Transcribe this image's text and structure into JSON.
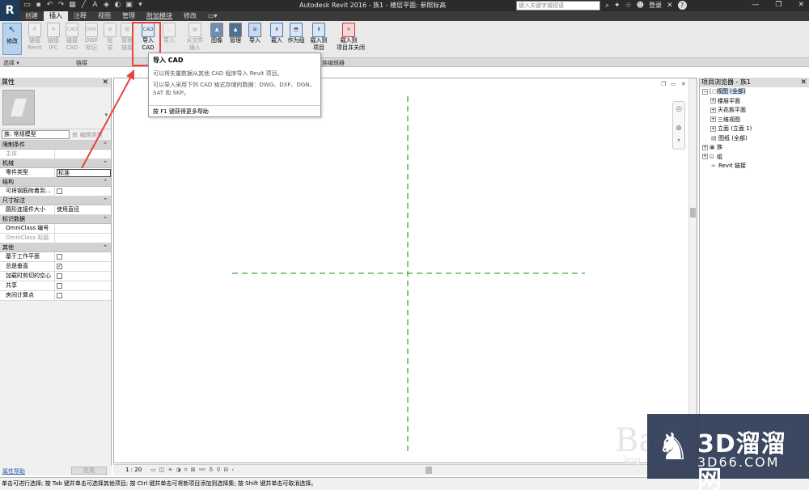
{
  "titlebar": {
    "app_logo": "R",
    "window_title": "Autodesk Revit 2016 -   族1 - 楼层平面: 参照标高",
    "search_placeholder": "键入关键字或短语",
    "login": "登录",
    "help": "?"
  },
  "tabs": [
    "创建",
    "插入",
    "注释",
    "视图",
    "管理",
    "附加模块",
    "修改"
  ],
  "active_tab": "插入",
  "ribbon": {
    "modify": "修改",
    "link_revit": [
      "链接",
      "Revit"
    ],
    "link_ifc": [
      "链接",
      "IFC"
    ],
    "link_cad": [
      "链接",
      "CAD"
    ],
    "dwf_markup": [
      "DWF",
      "标记"
    ],
    "decal": [
      "贴",
      "花"
    ],
    "manage_links": [
      "管理",
      "链接"
    ],
    "import_cad": [
      "导入",
      "CAD"
    ],
    "import_gbxml": [
      "导入",
      ""
    ],
    "from_file": [
      "从文件",
      "插入"
    ],
    "image": [
      "图像",
      ""
    ],
    "manage_images": [
      "管理",
      ""
    ],
    "import_family_types": [
      "导入",
      ""
    ],
    "load_family": [
      "载入",
      "族"
    ],
    "load_as_group": [
      "作为组",
      "载入"
    ],
    "load_into_project": [
      "载入到",
      "项目"
    ],
    "load_into_project_close": [
      "载入到",
      "项目并关闭"
    ]
  },
  "panels": {
    "select": "选择 ▾",
    "link": "链接",
    "family_editor": "族编辑器"
  },
  "tooltip": {
    "title": "导入 CAD",
    "line1": "可以将矢量数据从其他 CAD 程序导入 Revit 项目。",
    "line2": "可以导入采用下列 CAD 格式存储的数据：DWG、DXF、DGN、SAT 和 SKP。",
    "footer": "按 F1 键获得更多帮助"
  },
  "properties": {
    "title": "属性",
    "family_select": "族: 常规模型",
    "edit_type": "编辑类型",
    "sections": [
      {
        "name": "限制条件",
        "rows": [
          {
            "k": "主体",
            "v": "",
            "disabled": true
          }
        ]
      },
      {
        "name": "机械",
        "rows": [
          {
            "k": "零件类型",
            "v": "标准",
            "box": true
          }
        ]
      },
      {
        "name": "结构",
        "rows": [
          {
            "k": "可将钢筋附着到...",
            "v": "",
            "cb": false
          }
        ]
      },
      {
        "name": "尺寸标注",
        "rows": [
          {
            "k": "圆形连接件大小",
            "v": "使用直径"
          }
        ]
      },
      {
        "name": "标识数据",
        "rows": [
          {
            "k": "OmniClass 编号",
            "v": ""
          },
          {
            "k": "OmniClass 标题",
            "v": "",
            "disabled": true
          }
        ]
      },
      {
        "name": "其他",
        "rows": [
          {
            "k": "基于工作平面",
            "v": "",
            "cb": false
          },
          {
            "k": "总是垂直",
            "v": "",
            "cb": true
          },
          {
            "k": "加载时剪切的空心",
            "v": "",
            "cb": false
          },
          {
            "k": "共享",
            "v": "",
            "cb": false
          },
          {
            "k": "房间计算点",
            "v": "",
            "cb": false
          }
        ]
      }
    ],
    "help": "属性帮助",
    "apply": "应用"
  },
  "viewbar": {
    "scale": "1 : 20"
  },
  "project_browser": {
    "title": "项目浏览器 - 族1",
    "items": [
      {
        "depth": 0,
        "toggle": "−",
        "icon": "[○]",
        "label": "视图 (全部)",
        "selected": true
      },
      {
        "depth": 1,
        "toggle": "+",
        "icon": "",
        "label": "楼层平面"
      },
      {
        "depth": 1,
        "toggle": "+",
        "icon": "",
        "label": "天花板平面"
      },
      {
        "depth": 1,
        "toggle": "+",
        "icon": "",
        "label": "三维视图"
      },
      {
        "depth": 1,
        "toggle": "+",
        "icon": "",
        "label": "立面 (立面 1)"
      },
      {
        "depth": 0,
        "toggle": "",
        "icon": "▤",
        "label": "图纸 (全部)"
      },
      {
        "depth": 0,
        "toggle": "+",
        "icon": "▣",
        "label": "族"
      },
      {
        "depth": 0,
        "toggle": "+",
        "icon": "⊡",
        "label": "组"
      },
      {
        "depth": 0,
        "toggle": "",
        "icon": "∞",
        "label": "Revit 链接"
      }
    ]
  },
  "statusbar": {
    "text": "单击可进行选择; 按 Tab 键并单击可选择其他项目; 按 Ctrl 键并单击可将新项目添加到选择集; 按 Shift 键并单击可取消选择。"
  },
  "watermark": {
    "cn": "3D溜溜网",
    "en": "3D66.COM",
    "b": "Ba",
    "jing": "jing"
  },
  "colors": {
    "reference_plane": "#3aa83a",
    "highlight": "#e8433c",
    "selection": "#cfe3f7"
  }
}
